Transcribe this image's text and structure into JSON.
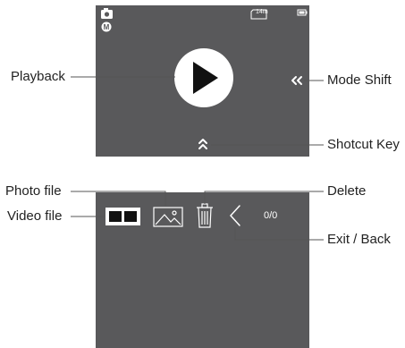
{
  "top_screen": {
    "callouts": {
      "playback": "Playback",
      "mode_shift": "Mode Shift",
      "shortcut_key": "Shotcut Key"
    },
    "status": {
      "remaining_time": "14m"
    }
  },
  "bottom_screen": {
    "callouts": {
      "photo_file": "Photo file",
      "video_file": "Video file",
      "delete": "Delete",
      "exit_back": "Exit / Back"
    },
    "counter": "0/0"
  },
  "colors": {
    "screen_bg": "#59595b",
    "icon": "#ffffff",
    "leader_line": "#555555"
  },
  "icons": [
    "camera-icon",
    "manual-mode-icon",
    "storage-card-icon",
    "battery-icon",
    "play-icon",
    "double-chevron-left-icon",
    "double-chevron-up-icon",
    "video-file-icon",
    "photo-file-icon",
    "trash-icon",
    "chevron-left-icon"
  ]
}
